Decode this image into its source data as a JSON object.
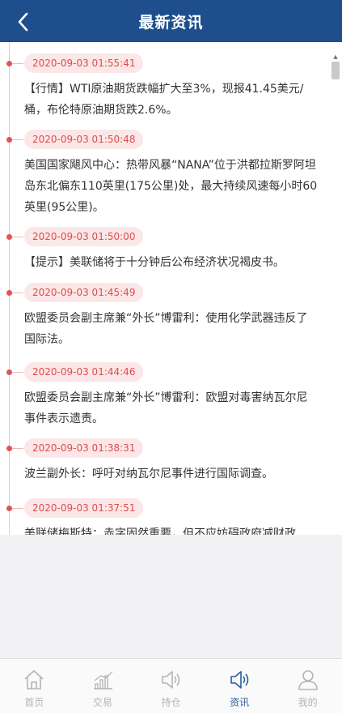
{
  "header": {
    "title": "最新资讯"
  },
  "news": [
    {
      "time": "2020-09-03 01:55:41",
      "text": "【行情】WTI原油期货跌幅扩大至3%，现报41.45美元/桶，布伦特原油期货跌2.6%。"
    },
    {
      "time": "2020-09-03 01:50:48",
      "text": "美国国家飓风中心：热带风暴“NANA”位于洪都拉斯罗阿坦岛东北偏东110英里(175公里)处，最大持续风速每小时60英里(95公里)。"
    },
    {
      "time": "2020-09-03 01:50:00",
      "text": "【提示】美联储将于十分钟后公布经济状况褐皮书。"
    },
    {
      "time": "2020-09-03 01:45:49",
      "text": "欧盟委员会副主席兼“外长”博雷利：使用化学武器违反了国际法。"
    },
    {
      "time": "2020-09-03 01:44:46",
      "text": "欧盟委员会副主席兼“外长”博雷利：欧盟对毒害纳瓦尔尼事件表示遗责。"
    },
    {
      "time": "2020-09-03 01:38:31",
      "text": "波兰副外长：呼吁对纳瓦尔尼事件进行国际调查。"
    },
    {
      "time": "2020-09-03 01:37:51",
      "text": "美联储梅斯特：赤字固然重要，但不应妨碍政府减财政"
    }
  ],
  "tabs": [
    {
      "label": "首页",
      "icon": "home-icon"
    },
    {
      "label": "交易",
      "icon": "chart-icon"
    },
    {
      "label": "持仓",
      "icon": "speaker-icon"
    },
    {
      "label": "资讯",
      "icon": "speaker-icon",
      "active": true
    },
    {
      "label": "我的",
      "icon": "user-icon"
    }
  ],
  "colors": {
    "header": "#1e4f8c",
    "accent": "#e04c4c",
    "active_tab": "#2a5d9a"
  }
}
